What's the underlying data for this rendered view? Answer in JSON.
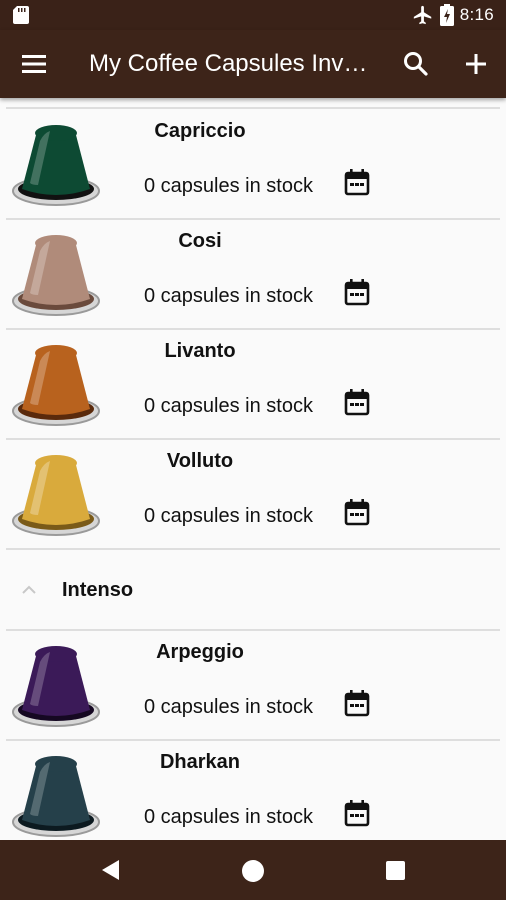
{
  "status_bar": {
    "time": "8:16",
    "icons": [
      "sd-card-icon",
      "airplane-icon",
      "battery-charging-icon"
    ]
  },
  "app_bar": {
    "title": "My Coffee Capsules Inv…",
    "menu_icon": "menu-icon",
    "search_icon": "search-icon",
    "add_icon": "add-icon"
  },
  "items": [
    {
      "name": "Capriccio",
      "stock": "0 capsules in stock",
      "color": "#0d4a33"
    },
    {
      "name": "Cosi",
      "stock": "0 capsules in stock",
      "color": "#b08b7a"
    },
    {
      "name": "Livanto",
      "stock": "0 capsules in stock",
      "color": "#b8621e"
    },
    {
      "name": "Volluto",
      "stock": "0 capsules in stock",
      "color": "#d9aa3c"
    },
    {
      "name": "Arpeggio",
      "stock": "0 capsules in stock",
      "color": "#3b1a58"
    },
    {
      "name": "Dharkan",
      "stock": "0 capsules in stock",
      "color": "#25404a"
    }
  ],
  "group": {
    "label": "Intenso"
  }
}
